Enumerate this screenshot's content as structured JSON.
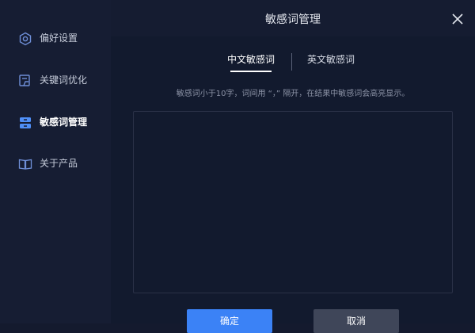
{
  "dialog": {
    "title": "敏感词管理"
  },
  "sidebar": {
    "items": [
      {
        "label": "偏好设置",
        "icon": "gear-icon"
      },
      {
        "label": "关键词优化",
        "icon": "edit-document-icon"
      },
      {
        "label": "敏感词管理",
        "icon": "drawer-icon",
        "active": true
      },
      {
        "label": "关于产品",
        "icon": "book-icon"
      }
    ]
  },
  "tabs": [
    {
      "label": "中文敏感词",
      "active": true
    },
    {
      "label": "英文敏感词",
      "active": false
    }
  ],
  "hint": "敏感词小于10字，词间用 “，” 隔开，在结果中敏感词会高亮显示。",
  "editor": {
    "value": ""
  },
  "buttons": {
    "ok_label": "确定",
    "cancel_label": "取消"
  },
  "colors": {
    "accent": "#3b82f6",
    "active_nav_icon": "#4f8ff7",
    "background": "#121a2e",
    "sidebar": "#161d33"
  }
}
